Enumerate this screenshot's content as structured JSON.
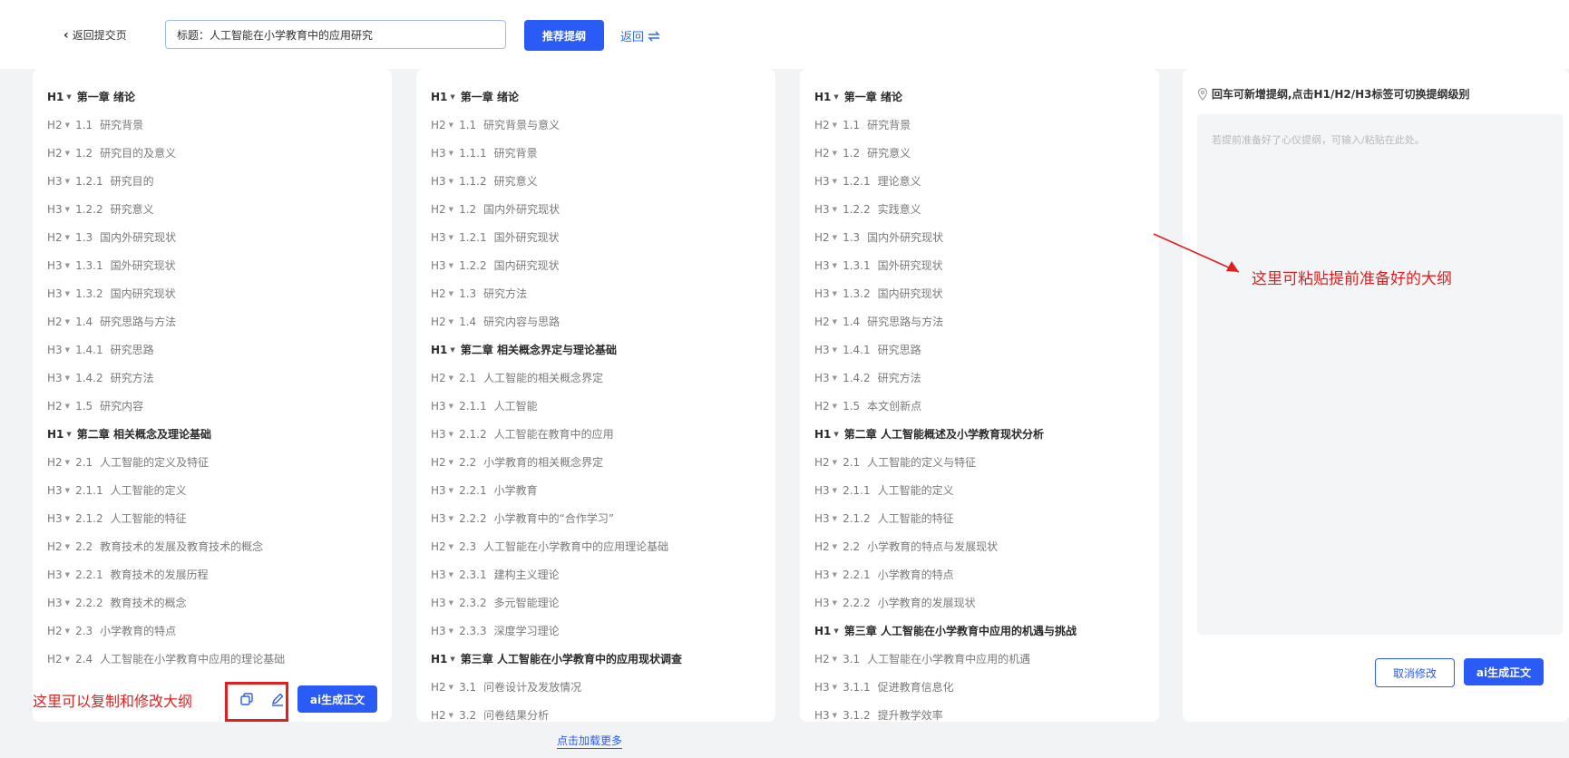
{
  "header": {
    "back_label": "返回提交页",
    "title_value": "标题：人工智能在小学教育中的应用研究",
    "recommend_label": "推荐提纲",
    "return_label": "返回"
  },
  "columns": [
    {
      "items": [
        {
          "level": "H1",
          "num": "",
          "text": "第一章 绪论"
        },
        {
          "level": "H2",
          "num": "1.1",
          "text": "研究背景"
        },
        {
          "level": "H2",
          "num": "1.2",
          "text": "研究目的及意义"
        },
        {
          "level": "H3",
          "num": "1.2.1",
          "text": "研究目的"
        },
        {
          "level": "H3",
          "num": "1.2.2",
          "text": "研究意义"
        },
        {
          "level": "H2",
          "num": "1.3",
          "text": "国内外研究现状"
        },
        {
          "level": "H3",
          "num": "1.3.1",
          "text": "国外研究现状"
        },
        {
          "level": "H3",
          "num": "1.3.2",
          "text": "国内研究现状"
        },
        {
          "level": "H2",
          "num": "1.4",
          "text": "研究思路与方法"
        },
        {
          "level": "H3",
          "num": "1.4.1",
          "text": "研究思路"
        },
        {
          "level": "H3",
          "num": "1.4.2",
          "text": "研究方法"
        },
        {
          "level": "H2",
          "num": "1.5",
          "text": "研究内容"
        },
        {
          "level": "H1",
          "num": "",
          "text": "第二章 相关概念及理论基础"
        },
        {
          "level": "H2",
          "num": "2.1",
          "text": "人工智能的定义及特征"
        },
        {
          "level": "H3",
          "num": "2.1.1",
          "text": "人工智能的定义"
        },
        {
          "level": "H3",
          "num": "2.1.2",
          "text": "人工智能的特征"
        },
        {
          "level": "H2",
          "num": "2.2",
          "text": "教育技术的发展及教育技术的概念"
        },
        {
          "level": "H3",
          "num": "2.2.1",
          "text": "教育技术的发展历程"
        },
        {
          "level": "H3",
          "num": "2.2.2",
          "text": "教育技术的概念"
        },
        {
          "level": "H2",
          "num": "2.3",
          "text": "小学教育的特点"
        },
        {
          "level": "H2",
          "num": "2.4",
          "text": "人工智能在小学教育中应用的理论基础"
        }
      ]
    },
    {
      "items": [
        {
          "level": "H1",
          "num": "",
          "text": "第一章 绪论"
        },
        {
          "level": "H2",
          "num": "1.1",
          "text": "研究背景与意义"
        },
        {
          "level": "H3",
          "num": "1.1.1",
          "text": "研究背景"
        },
        {
          "level": "H3",
          "num": "1.1.2",
          "text": "研究意义"
        },
        {
          "level": "H2",
          "num": "1.2",
          "text": "国内外研究现状"
        },
        {
          "level": "H3",
          "num": "1.2.1",
          "text": "国外研究现状"
        },
        {
          "level": "H3",
          "num": "1.2.2",
          "text": "国内研究现状"
        },
        {
          "level": "H2",
          "num": "1.3",
          "text": "研究方法"
        },
        {
          "level": "H2",
          "num": "1.4",
          "text": "研究内容与思路"
        },
        {
          "level": "H1",
          "num": "",
          "text": "第二章 相关概念界定与理论基础"
        },
        {
          "level": "H2",
          "num": "2.1",
          "text": "人工智能的相关概念界定"
        },
        {
          "level": "H3",
          "num": "2.1.1",
          "text": "人工智能"
        },
        {
          "level": "H3",
          "num": "2.1.2",
          "text": "人工智能在教育中的应用"
        },
        {
          "level": "H2",
          "num": "2.2",
          "text": "小学教育的相关概念界定"
        },
        {
          "level": "H3",
          "num": "2.2.1",
          "text": "小学教育"
        },
        {
          "level": "H3",
          "num": "2.2.2",
          "text": "小学教育中的“合作学习”"
        },
        {
          "level": "H2",
          "num": "2.3",
          "text": "人工智能在小学教育中的应用理论基础"
        },
        {
          "level": "H3",
          "num": "2.3.1",
          "text": "建构主义理论"
        },
        {
          "level": "H3",
          "num": "2.3.2",
          "text": "多元智能理论"
        },
        {
          "level": "H3",
          "num": "2.3.3",
          "text": "深度学习理论"
        },
        {
          "level": "H1",
          "num": "",
          "text": "第三章 人工智能在小学教育中的应用现状调查"
        },
        {
          "level": "H2",
          "num": "3.1",
          "text": "问卷设计及发放情况"
        },
        {
          "level": "H2",
          "num": "3.2",
          "text": "问卷结果分析"
        }
      ]
    },
    {
      "items": [
        {
          "level": "H1",
          "num": "",
          "text": "第一章 绪论"
        },
        {
          "level": "H2",
          "num": "1.1",
          "text": "研究背景"
        },
        {
          "level": "H2",
          "num": "1.2",
          "text": "研究意义"
        },
        {
          "level": "H3",
          "num": "1.2.1",
          "text": "理论意义"
        },
        {
          "level": "H3",
          "num": "1.2.2",
          "text": "实践意义"
        },
        {
          "level": "H2",
          "num": "1.3",
          "text": "国内外研究现状"
        },
        {
          "level": "H3",
          "num": "1.3.1",
          "text": "国外研究现状"
        },
        {
          "level": "H3",
          "num": "1.3.2",
          "text": "国内研究现状"
        },
        {
          "level": "H2",
          "num": "1.4",
          "text": "研究思路与方法"
        },
        {
          "level": "H3",
          "num": "1.4.1",
          "text": "研究思路"
        },
        {
          "level": "H3",
          "num": "1.4.2",
          "text": "研究方法"
        },
        {
          "level": "H2",
          "num": "1.5",
          "text": "本文创新点"
        },
        {
          "level": "H1",
          "num": "",
          "text": "第二章 人工智能概述及小学教育现状分析"
        },
        {
          "level": "H2",
          "num": "2.1",
          "text": "人工智能的定义与特征"
        },
        {
          "level": "H3",
          "num": "2.1.1",
          "text": "人工智能的定义"
        },
        {
          "level": "H3",
          "num": "2.1.2",
          "text": "人工智能的特征"
        },
        {
          "level": "H2",
          "num": "2.2",
          "text": "小学教育的特点与发展现状"
        },
        {
          "level": "H3",
          "num": "2.2.1",
          "text": "小学教育的特点"
        },
        {
          "level": "H3",
          "num": "2.2.2",
          "text": "小学教育的发展现状"
        },
        {
          "level": "H1",
          "num": "",
          "text": "第三章 人工智能在小学教育中应用的机遇与挑战"
        },
        {
          "level": "H2",
          "num": "3.1",
          "text": "人工智能在小学教育中应用的机遇"
        },
        {
          "level": "H3",
          "num": "3.1.1",
          "text": "促进教育信息化"
        },
        {
          "level": "H3",
          "num": "3.1.2",
          "text": "提升教学效率"
        }
      ]
    }
  ],
  "panel_actions": {
    "generate_label": "ai生成正文"
  },
  "right_panel": {
    "hint": "回车可新增提纲,点击H1/H2/H3标签可切换提纲级别",
    "placeholder": "若提前准备好了心仪提纲，可输入/粘贴在此处。",
    "cancel_label": "取消修改",
    "generate_label": "ai生成正文"
  },
  "annotations": {
    "left": "这里可以复制和修改大纲",
    "right": "这里可粘贴提前准备好的大纲"
  },
  "footer": {
    "load_more": "点击加载更多"
  },
  "colors": {
    "primary": "#2a5bf6",
    "annotation": "#e02020"
  }
}
